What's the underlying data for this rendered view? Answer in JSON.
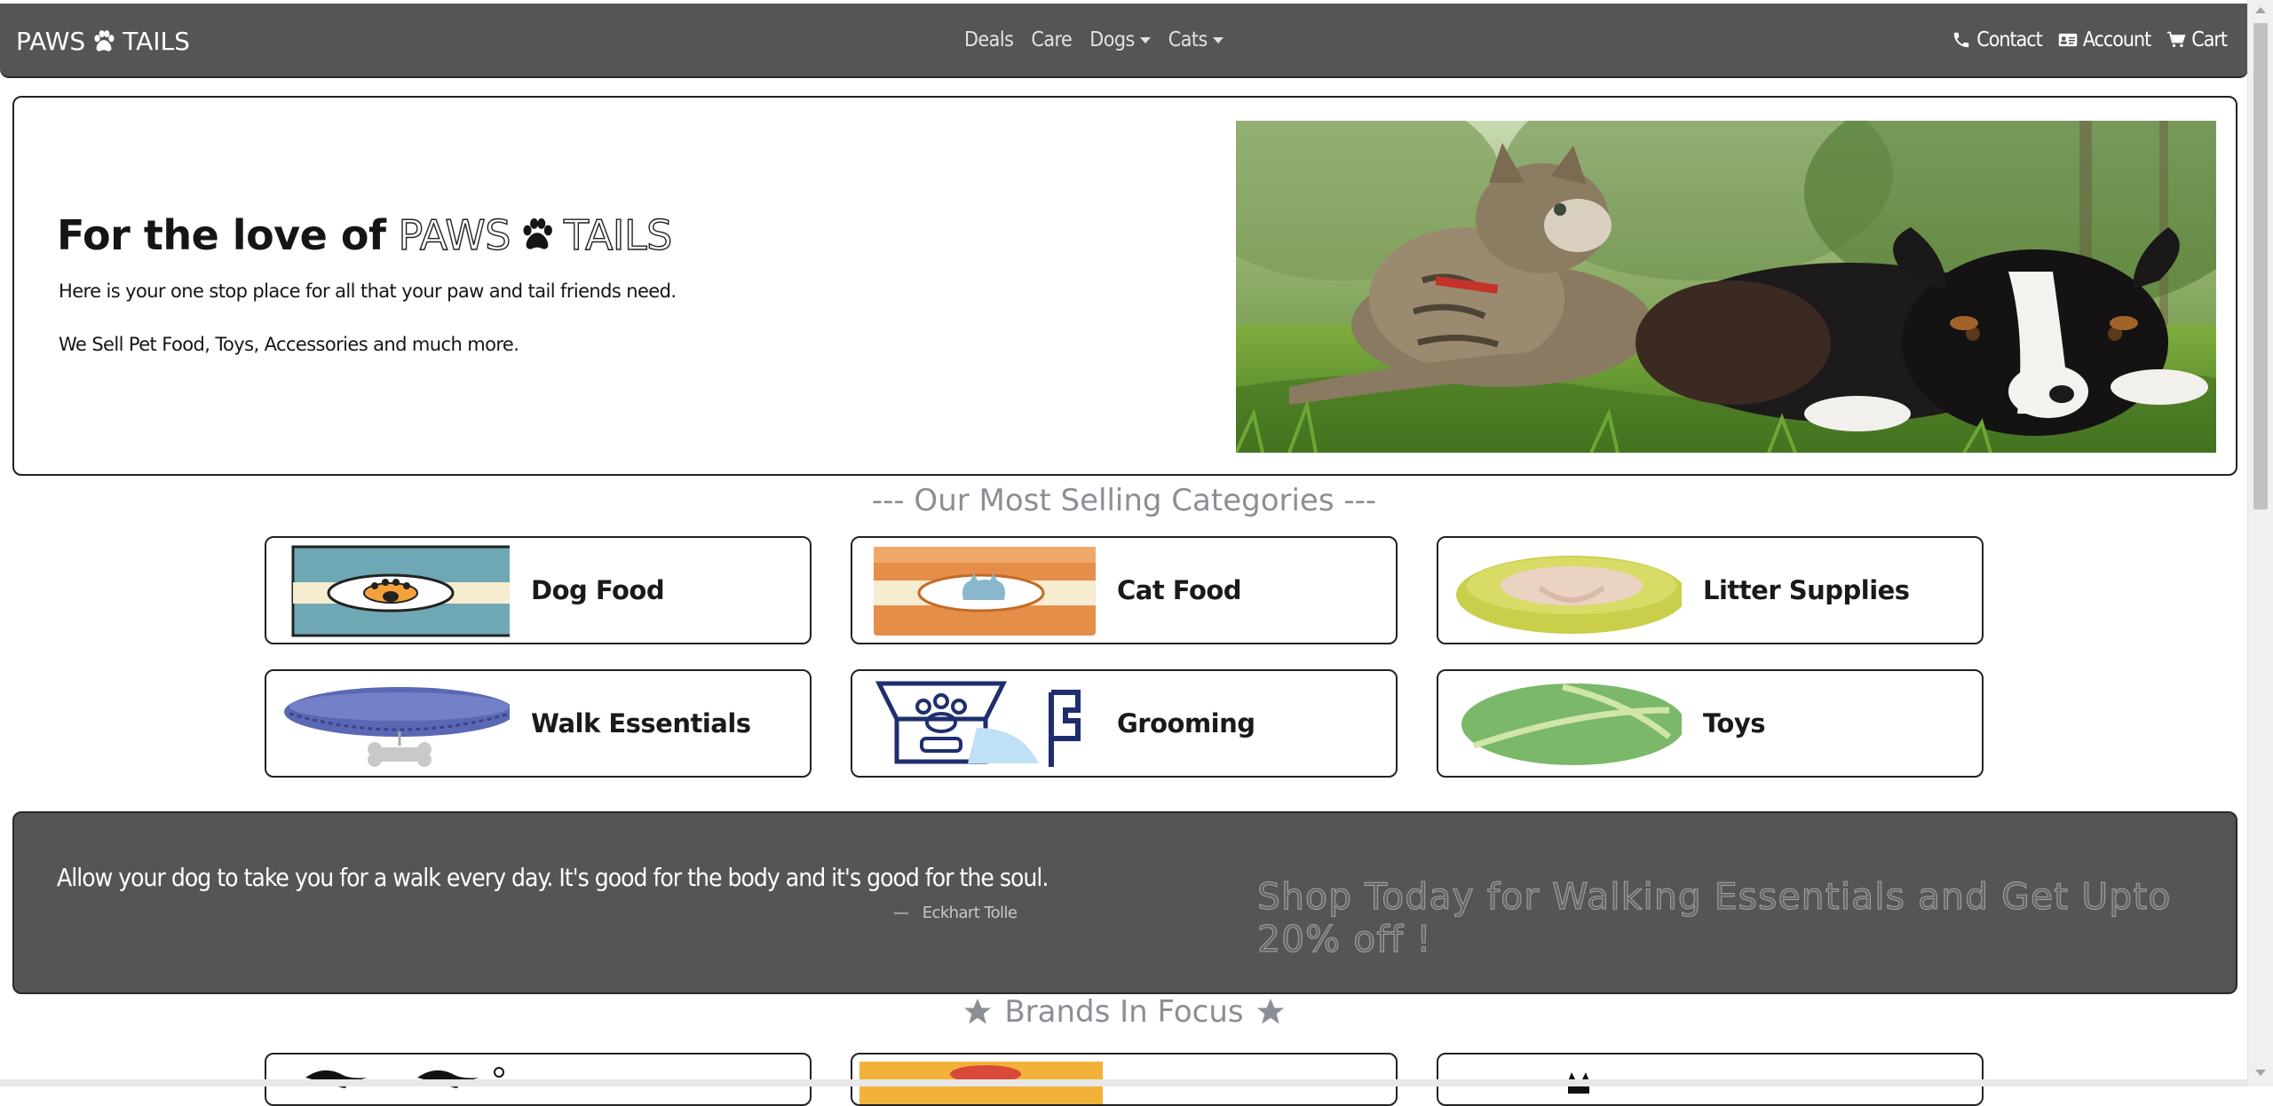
{
  "navbar": {
    "brand_left": "PAWS",
    "brand_right": "TAILS",
    "brand_icon": "paw-icon",
    "links": [
      {
        "label": "Deals",
        "dropdown": false
      },
      {
        "label": "Care",
        "dropdown": false
      },
      {
        "label": "Dogs",
        "dropdown": true
      },
      {
        "label": "Cats",
        "dropdown": true
      }
    ],
    "right_links": [
      {
        "label": "Contact",
        "icon": "phone-icon"
      },
      {
        "label": "Account",
        "icon": "id-card-icon"
      },
      {
        "label": "Cart",
        "icon": "cart-icon"
      }
    ],
    "bg_color": "#555555"
  },
  "hero": {
    "title_prefix": "For the love of",
    "brand_left": "PAWS",
    "brand_right": "TAILS",
    "line1": "Here is your one stop place for all that your paw and tail friends need.",
    "line2": "We Sell Pet Food, Toys, Accessories and much more.",
    "photo": "cat and dog lying on grass"
  },
  "categories": {
    "heading": "--- Our Most Selling Categories ---",
    "items": [
      {
        "label": "Dog Food",
        "icon": "dog-food-can-icon"
      },
      {
        "label": "Cat Food",
        "icon": "cat-food-bag-icon"
      },
      {
        "label": "Litter Supplies",
        "icon": "pet-bed-icon"
      },
      {
        "label": "Walk Essentials",
        "icon": "collar-icon"
      },
      {
        "label": "Grooming",
        "icon": "grooming-brush-icon"
      },
      {
        "label": "Toys",
        "icon": "ball-toy-icon"
      }
    ]
  },
  "banner": {
    "quote": "Allow your dog to take you for a walk every day. It's good for the body and it's good for the soul.",
    "author": "Eckhart Tolle",
    "author_prefix": "—",
    "promo": "Shop Today for Walking Essentials and Get Upto 20% off !"
  },
  "brands": {
    "heading": "Brands In Focus",
    "heading_icon": "star-icon"
  }
}
